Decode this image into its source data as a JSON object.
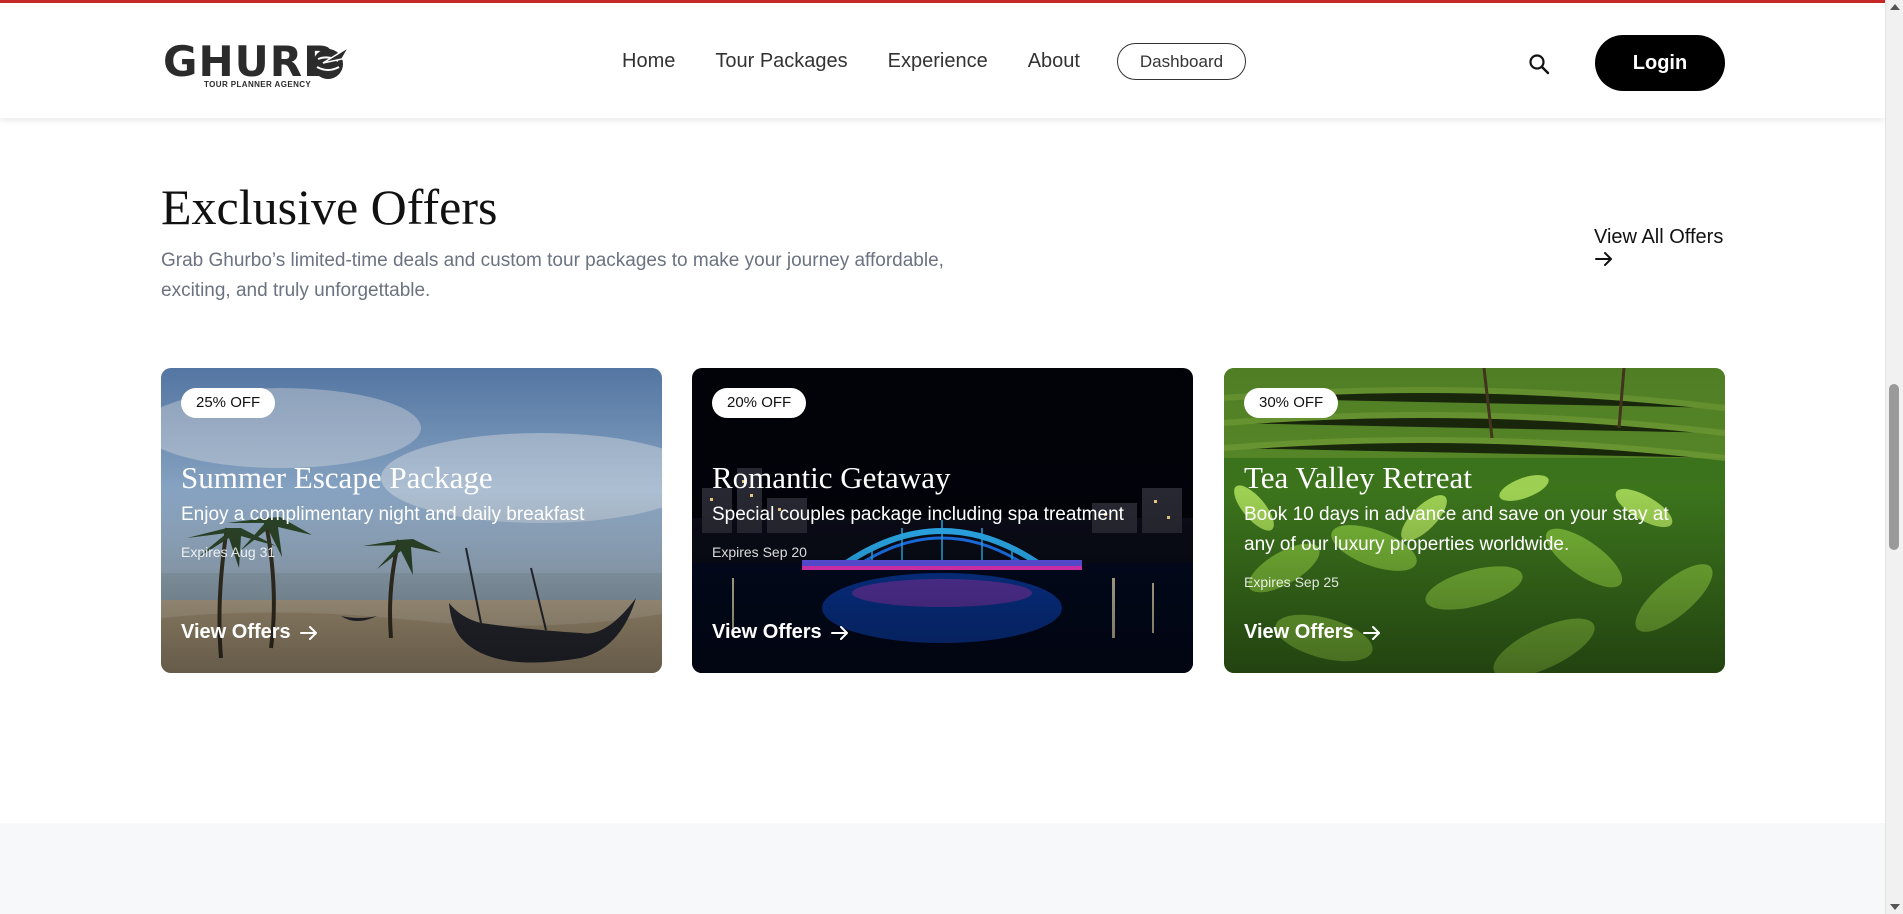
{
  "header": {
    "logo": {
      "word": "GHURB",
      "tagline": "TOUR PLANNER AGENCY"
    },
    "nav": [
      {
        "label": "Home"
      },
      {
        "label": "Tour Packages"
      },
      {
        "label": "Experience"
      },
      {
        "label": "About"
      }
    ],
    "dashboard_label": "Dashboard",
    "search_icon": "search-icon",
    "login_label": "Login"
  },
  "offers": {
    "title": "Exclusive Offers",
    "description": "Grab Ghurbo’s limited-time deals and custom tour packages to make your journey affordable, exciting, and truly unforgettable.",
    "view_all_label": "View All Offers",
    "cards": [
      {
        "badge": "25% OFF",
        "title": "Summer Escape Package",
        "description": "Enjoy a complimentary night and daily breakfast",
        "expires": "Expires Aug 31",
        "link_label": "View Offers"
      },
      {
        "badge": "20% OFF",
        "title": "Romantic Getaway",
        "description": "Special couples package including spa treatment",
        "expires": "Expires Sep 20",
        "link_label": "View Offers"
      },
      {
        "badge": "30% OFF",
        "title": "Tea Valley Retreat",
        "description": "Book 10 days in advance and save on your stay at any of our luxury properties worldwide.",
        "expires": "Expires Sep 25",
        "link_label": "View Offers"
      }
    ]
  },
  "colors": {
    "accent_top": "#c62828",
    "button_dark": "#000000",
    "muted_text": "#6b7280"
  }
}
